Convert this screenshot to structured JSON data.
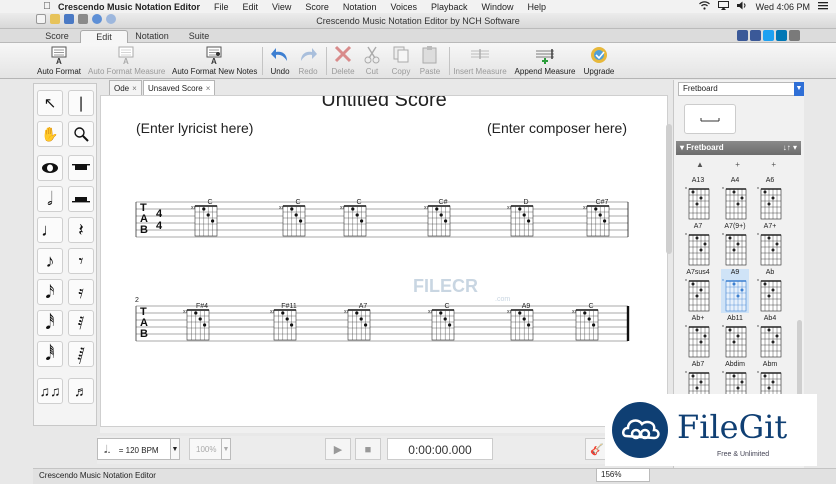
{
  "menubar": {
    "app": "Crescendo Music Notation Editor",
    "menus": [
      "File",
      "Edit",
      "View",
      "Score",
      "Notation",
      "Voices",
      "Playback",
      "Window",
      "Help"
    ],
    "clock": "Wed 4:06 PM"
  },
  "window": {
    "title": "Crescendo Music Notation Editor by NCH Software"
  },
  "tabs": [
    "Score",
    "Edit",
    "Notation",
    "Suite"
  ],
  "toolbar": {
    "auto_format": "Auto Format",
    "auto_format_measure": "Auto Format Measure",
    "auto_format_new_notes": "Auto Format New Notes",
    "undo": "Undo",
    "redo": "Redo",
    "delete": "Delete",
    "cut": "Cut",
    "copy": "Copy",
    "paste": "Paste",
    "insert_measure": "Insert Measure",
    "append_measure": "Append Measure",
    "upgrade": "Upgrade"
  },
  "doc_tabs": [
    {
      "label": "Ode"
    },
    {
      "label": "Unsaved Score"
    }
  ],
  "score": {
    "title": "Untitled Score",
    "lyricist": "(Enter lyricist here)",
    "composer": "(Enter composer here)",
    "system1_chords": [
      "C",
      "C",
      "C",
      "C#",
      "D",
      "C#7"
    ],
    "system2_measure": "2",
    "system2_chords": [
      "F#4",
      "F#11",
      "A7",
      "C",
      "A9",
      "C"
    ],
    "tab_label": [
      "T",
      "A",
      "B"
    ]
  },
  "watermark": {
    "text": "FILECR",
    "sub": ".com"
  },
  "bottom": {
    "tempo": "= 120 BPM",
    "zoom_disabled": "100%",
    "time": "0:00:00.000"
  },
  "status": {
    "text": "Crescendo Music Notation Editor",
    "zoom": "156%"
  },
  "right_panel": {
    "selector": "Fretboard",
    "header": "Fretboard",
    "header_controls": "↓↑ ▾",
    "chords": [
      "A13",
      "A4",
      "A6",
      "A7",
      "A7(9+)",
      "A7+",
      "A7sus4",
      "A9",
      "Ab",
      "Ab+",
      "Ab11",
      "Ab4",
      "Ab7",
      "Abdim",
      "Abm"
    ],
    "selected": "A9"
  },
  "filegit": {
    "brand": "FileGit",
    "tagline": "Free & Unlimited"
  },
  "colors": {
    "accent": "#2f6fd6",
    "brand": "#0f3f73"
  }
}
